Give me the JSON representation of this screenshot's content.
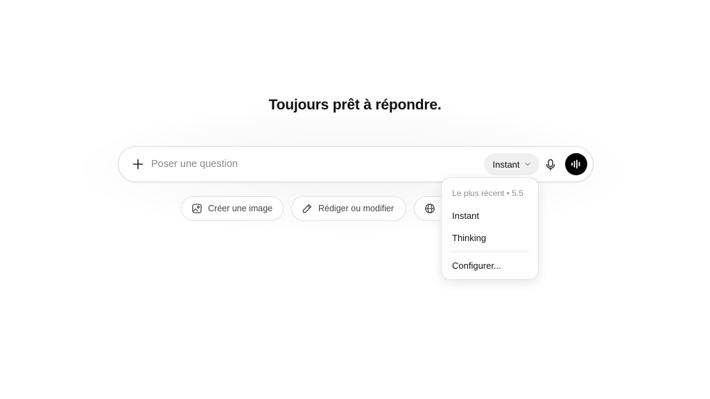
{
  "headline": "Toujours prêt à répondre.",
  "composer": {
    "placeholder": "Poser une question",
    "model_label": "Instant",
    "icons": {
      "add": "plus-icon",
      "model_dropdown": "chevron-down-icon",
      "mic": "microphone-icon",
      "voice": "voice-waveform-icon"
    }
  },
  "suggestions": [
    {
      "label": "Créer une image",
      "icon": "image-icon"
    },
    {
      "label": "Rédiger ou modifier",
      "icon": "pencil-icon"
    },
    {
      "label": "",
      "icon": "globe-icon"
    }
  ],
  "model_menu": {
    "header": "Le plus récent • 5.5",
    "items": [
      "Instant",
      "Thinking"
    ],
    "configure": "Configurer..."
  },
  "colors": {
    "background": "#ffffff",
    "voice_button": "#000000",
    "model_pill": "#f0f0f0",
    "placeholder_text": "#8a8a8a"
  }
}
